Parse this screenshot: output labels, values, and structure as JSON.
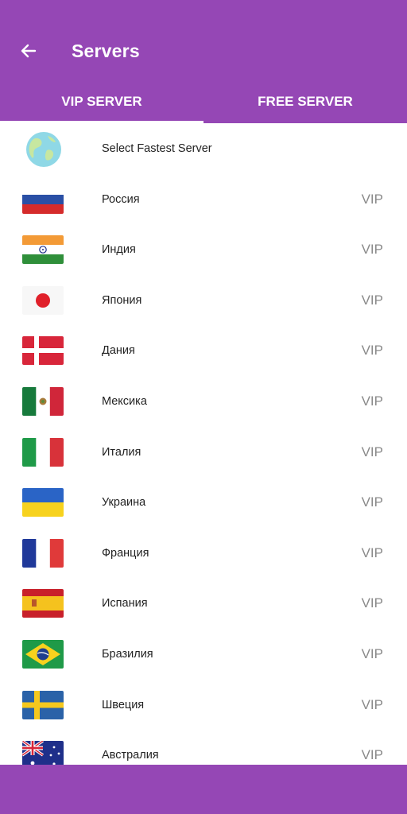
{
  "header": {
    "title": "Servers",
    "back_icon": "arrow-left-icon"
  },
  "tabs": [
    {
      "label": "VIP SERVER",
      "active": true
    },
    {
      "label": "FREE SERVER",
      "active": false
    }
  ],
  "fastest": {
    "label": "Select Fastest Server",
    "icon": "globe-icon"
  },
  "servers": [
    {
      "name": "Россия",
      "badge": "VIP",
      "flag": "russia-flag-icon"
    },
    {
      "name": "Индия",
      "badge": "VIP",
      "flag": "india-flag-icon"
    },
    {
      "name": "Япония",
      "badge": "VIP",
      "flag": "japan-flag-icon"
    },
    {
      "name": "Дания",
      "badge": "VIP",
      "flag": "denmark-flag-icon"
    },
    {
      "name": "Мексика",
      "badge": "VIP",
      "flag": "mexico-flag-icon"
    },
    {
      "name": "Италия",
      "badge": "VIP",
      "flag": "italy-flag-icon"
    },
    {
      "name": "Украина",
      "badge": "VIP",
      "flag": "ukraine-flag-icon"
    },
    {
      "name": "Франция",
      "badge": "VIP",
      "flag": "france-flag-icon"
    },
    {
      "name": "Испания",
      "badge": "VIP",
      "flag": "spain-flag-icon"
    },
    {
      "name": "Бразилия",
      "badge": "VIP",
      "flag": "brazil-flag-icon"
    },
    {
      "name": "Швеция",
      "badge": "VIP",
      "flag": "sweden-flag-icon"
    },
    {
      "name": "Австралия",
      "badge": "VIP",
      "flag": "australia-flag-icon"
    }
  ],
  "colors": {
    "primary": "#9547b5",
    "text": "#222222",
    "badge": "#8a8a8a"
  }
}
